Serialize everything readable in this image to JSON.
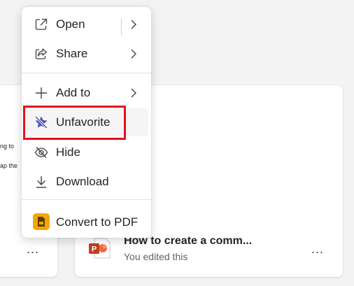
{
  "menu": {
    "open_label": "Open",
    "share_label": "Share",
    "add_to_label": "Add to",
    "unfavorite_label": "Unfavorite",
    "hide_label": "Hide",
    "download_label": "Download",
    "convert_label": "Convert to PDF"
  },
  "left_card": {
    "snippet_1": "ng to",
    "snippet_2": "ap the",
    "more_label": "..."
  },
  "right_card": {
    "file_title": "How to create a comm...",
    "file_subtitle": "You edited this",
    "more_label": "..."
  },
  "colors": {
    "highlight": "#e3101c",
    "unfavorite_icon": "#4f52b2",
    "pdf_icon": "#f2a600",
    "powerpoint_icon": "#c43e1c"
  },
  "icons": {
    "open": "open-external-icon",
    "share": "share-icon",
    "add_to": "plus-icon",
    "unfavorite": "star-off-icon",
    "hide": "eye-off-icon",
    "download": "download-icon",
    "convert": "pdf-icon"
  }
}
